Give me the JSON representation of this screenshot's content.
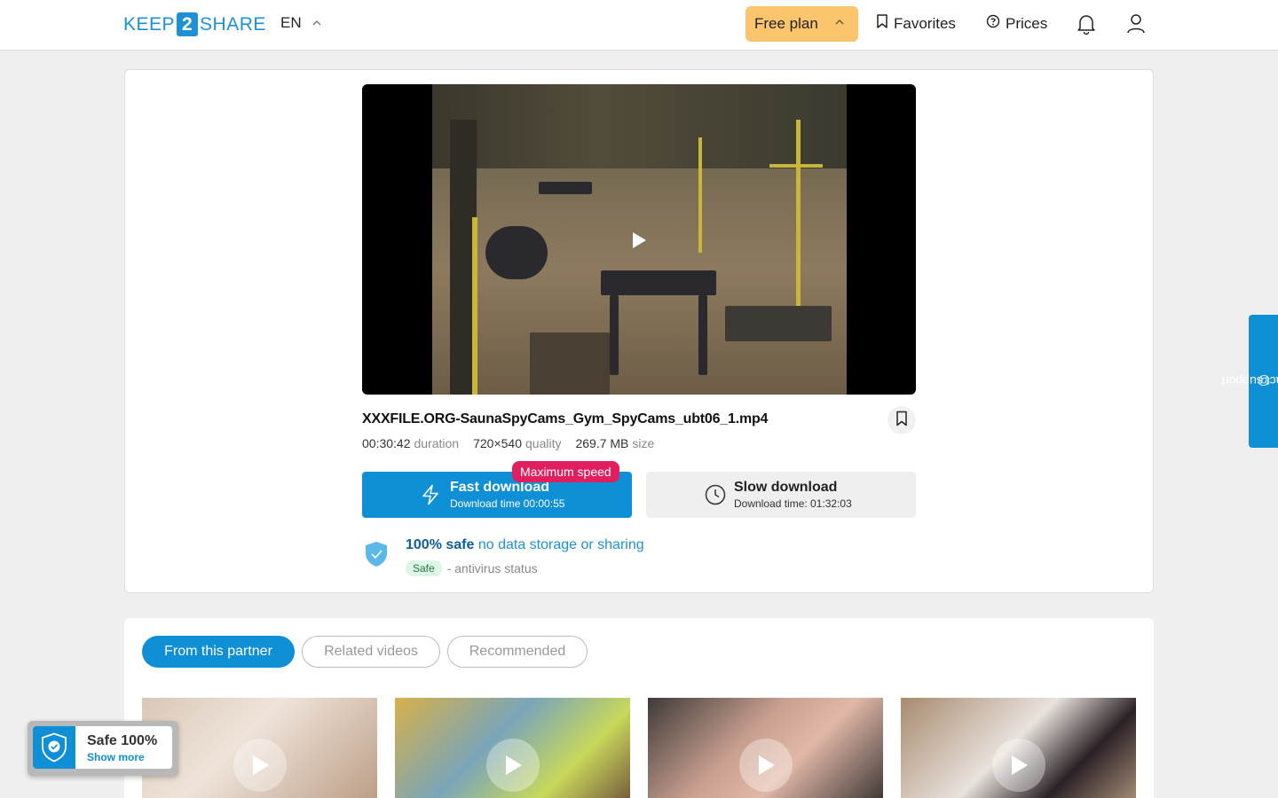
{
  "header": {
    "logo_prefix": "KEEP",
    "logo_mid": "2",
    "logo_suffix": "SHARE",
    "language": "EN",
    "plan_label": "Free plan",
    "favorites_label": "Favorites",
    "prices_label": "Prices"
  },
  "file": {
    "name": "XXXFILE.ORG-SaunaSpyCams_Gym_SpyCams_ubt06_1.mp4",
    "duration_value": "00:30:42",
    "duration_unit": "duration",
    "quality_value": "720×540",
    "quality_unit": "quality",
    "size_value": "269.7 MB",
    "size_unit": "size"
  },
  "download": {
    "max_speed_badge": "Maximum speed",
    "fast_label": "Fast download",
    "fast_sub": "Download time 00:00:55",
    "slow_label": "Slow download",
    "slow_sub": "Download time: 01:32:03"
  },
  "safety": {
    "strong": "100% safe",
    "light": "no data storage or sharing",
    "badge": "Safe",
    "status_text": "- antivirus status"
  },
  "tabs": [
    {
      "label": "From this partner",
      "active": true
    },
    {
      "label": "Related videos",
      "active": false
    },
    {
      "label": "Recommended",
      "active": false
    }
  ],
  "support_label": "contact support",
  "safe_widget": {
    "title": "Safe 100%",
    "link": "Show more"
  },
  "colors": {
    "accent": "#0f8fd6",
    "plan": "#fbc46d",
    "badge": "#e21f5e"
  }
}
